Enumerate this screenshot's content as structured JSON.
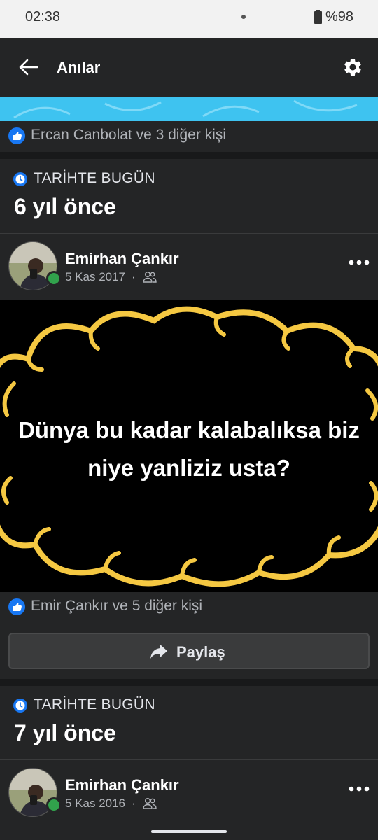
{
  "status_bar": {
    "time": "02:38",
    "battery": "%98"
  },
  "app_bar": {
    "title": "Anılar"
  },
  "top_card": {
    "reaction_text": "Ercan Canbolat ve 3 diğer kişi"
  },
  "memories": [
    {
      "section_label": "TARİHTE BUGÜN",
      "years_ago": "6 yıl önce",
      "author": "Emirhan Çankır",
      "date": "5 Kas 2017",
      "separator": "·",
      "post_text_line1": "Dünya bu kadar kalabalıksa biz",
      "post_text_line2": "niye yanliziz usta?",
      "reaction_text": "Emir Çankır ve 5 diğer kişi",
      "share_label": "Paylaş"
    },
    {
      "section_label": "TARİHTE BUGÜN",
      "years_ago": "7 yıl önce",
      "author": "Emirhan Çankır",
      "date": "5 Kas 2016",
      "separator": "·"
    }
  ],
  "colors": {
    "background": "#18191a",
    "card": "#242526",
    "accent_blue": "#1877f2",
    "online_green": "#31a24c",
    "cloud_yellow": "#f5c842",
    "banner_cyan": "#3ec3f0"
  }
}
